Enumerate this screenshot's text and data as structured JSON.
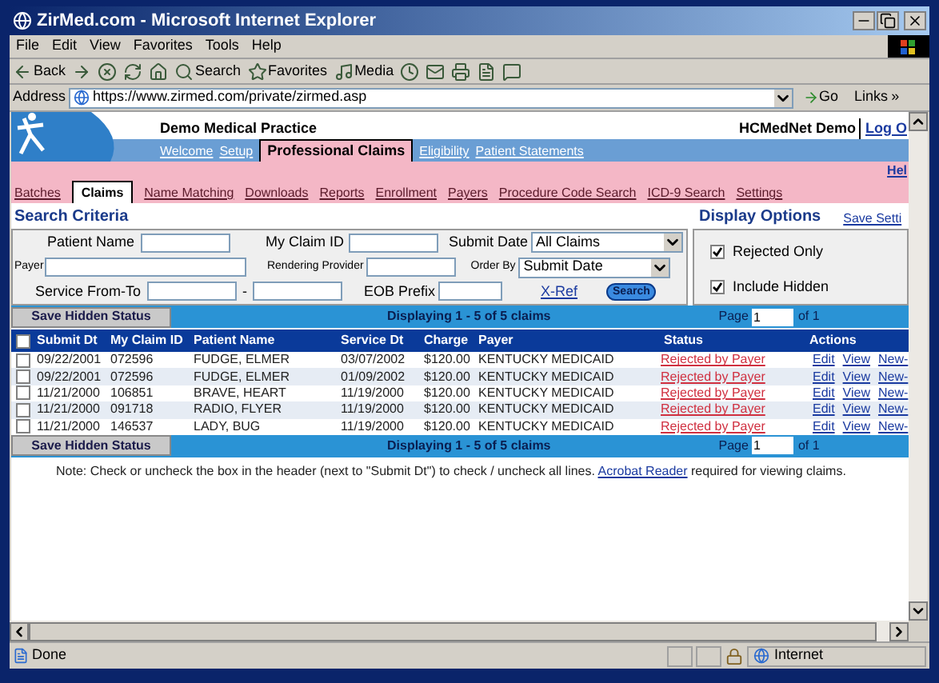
{
  "window": {
    "title": "ZirMed.com - Microsoft Internet Explorer"
  },
  "menu": [
    "File",
    "Edit",
    "View",
    "Favorites",
    "Tools",
    "Help"
  ],
  "toolbar": [
    {
      "kind": "back",
      "label": "Back"
    },
    {
      "kind": "forward"
    },
    {
      "kind": "stop"
    },
    {
      "kind": "refresh"
    },
    {
      "kind": "home"
    },
    {
      "kind": "search",
      "label": "Search"
    },
    {
      "kind": "favorites",
      "label": "Favorites"
    },
    {
      "kind": "media",
      "label": "Media"
    },
    {
      "kind": "history"
    },
    {
      "kind": "mail"
    },
    {
      "kind": "print"
    },
    {
      "kind": "edit"
    },
    {
      "kind": "discuss"
    }
  ],
  "address": {
    "label": "Address",
    "url": "https://www.zirmed.com/private/zirmed.asp",
    "go": "Go",
    "links": "Links",
    "links_chevron": "»"
  },
  "page_header": {
    "practice": "Demo Medical Practice",
    "user": "HCMedNet Demo",
    "logout": "Log O"
  },
  "nav": [
    {
      "label": "Welcome",
      "selected": false
    },
    {
      "label": "Setup",
      "selected": false
    },
    {
      "label": "Professional Claims",
      "selected": true
    },
    {
      "label": "Eligibility",
      "selected": false
    },
    {
      "label": "Patient Statements",
      "selected": false
    }
  ],
  "help": "Hel",
  "subtabs": [
    {
      "label": "Batches",
      "selected": false
    },
    {
      "label": "Claims",
      "selected": true
    },
    {
      "label": "Name Matching",
      "selected": false
    },
    {
      "label": "Downloads",
      "selected": false
    },
    {
      "label": "Reports",
      "selected": false
    },
    {
      "label": "Enrollment",
      "selected": false
    },
    {
      "label": "Payers",
      "selected": false
    },
    {
      "label": "Procedure Code Search",
      "selected": false
    },
    {
      "label": "ICD-9 Search",
      "selected": false
    },
    {
      "label": "Settings",
      "selected": false
    }
  ],
  "search": {
    "title": "Search Criteria",
    "patient_name_label": "Patient Name",
    "claim_id_label": "My Claim ID",
    "submit_date_label": "Submit Date",
    "submit_date_value": "All Claims",
    "payer_label": "Payer",
    "provider_label": "Rendering Provider",
    "order_by_label": "Order By",
    "order_by_value": "Submit Date",
    "service_label": "Service From-To",
    "range_dash": "-",
    "eob_label": "EOB Prefix",
    "xref": "X-Ref",
    "search_button": "Search"
  },
  "display_options": {
    "title": "Display Options",
    "save": "Save Setti",
    "options": [
      {
        "label": "Rejected Only",
        "checked": true
      },
      {
        "label": "Include Hidden",
        "checked": true
      }
    ]
  },
  "results_bar": {
    "save_button": "Save Hidden Status",
    "displaying": "Displaying 1 - 5 of 5 claims",
    "page_label": "Page",
    "page_value": "1",
    "of": "of 1"
  },
  "table": {
    "select_all": {
      "checked": false
    },
    "columns": [
      "Submit Dt",
      "My Claim ID",
      "Patient Name",
      "Service Dt",
      "Charge",
      "Payer",
      "Status",
      "Actions"
    ],
    "rows": [
      {
        "checked": false,
        "cells": [
          "09/22/2001",
          "072596",
          "FUDGE, ELMER",
          "03/07/2002",
          "$120.00",
          "KENTUCKY MEDICAID"
        ],
        "status": "Rejected by Payer",
        "actions": [
          "Edit",
          "View",
          "New-"
        ]
      },
      {
        "checked": false,
        "cells": [
          "09/22/2001",
          "072596",
          "FUDGE, ELMER",
          "01/09/2002",
          "$120.00",
          "KENTUCKY MEDICAID"
        ],
        "status": "Rejected by Payer",
        "actions": [
          "Edit",
          "View",
          "New-"
        ]
      },
      {
        "checked": false,
        "cells": [
          "11/21/2000",
          "106851",
          "BRAVE, HEART",
          "11/19/2000",
          "$120.00",
          "KENTUCKY MEDICAID"
        ],
        "status": "Rejected by Payer",
        "actions": [
          "Edit",
          "View",
          "New-"
        ]
      },
      {
        "checked": false,
        "cells": [
          "11/21/2000",
          "091718",
          "RADIO, FLYER",
          "11/19/2000",
          "$120.00",
          "KENTUCKY MEDICAID"
        ],
        "status": "Rejected by Payer",
        "actions": [
          "Edit",
          "View",
          "New-"
        ]
      },
      {
        "checked": false,
        "cells": [
          "11/21/2000",
          "146537",
          "LADY, BUG",
          "11/19/2000",
          "$120.00",
          "KENTUCKY MEDICAID"
        ],
        "status": "Rejected by Payer",
        "actions": [
          "Edit",
          "View",
          "New-"
        ]
      }
    ]
  },
  "bottom_bar": {
    "save_button": "Save Hidden Status",
    "displaying": "Displaying 1 - 5 of 5 claims",
    "page_label": "Page",
    "page_value": "1",
    "of": "of 1"
  },
  "note": {
    "before": "Note: Check or uncheck the box in the header (next to \"Submit Dt\") to check / uncheck all lines.",
    "link": "Acrobat Reader",
    "after": "required for viewing claims."
  },
  "status_bar": {
    "text": "Done",
    "zone": "Internet"
  }
}
